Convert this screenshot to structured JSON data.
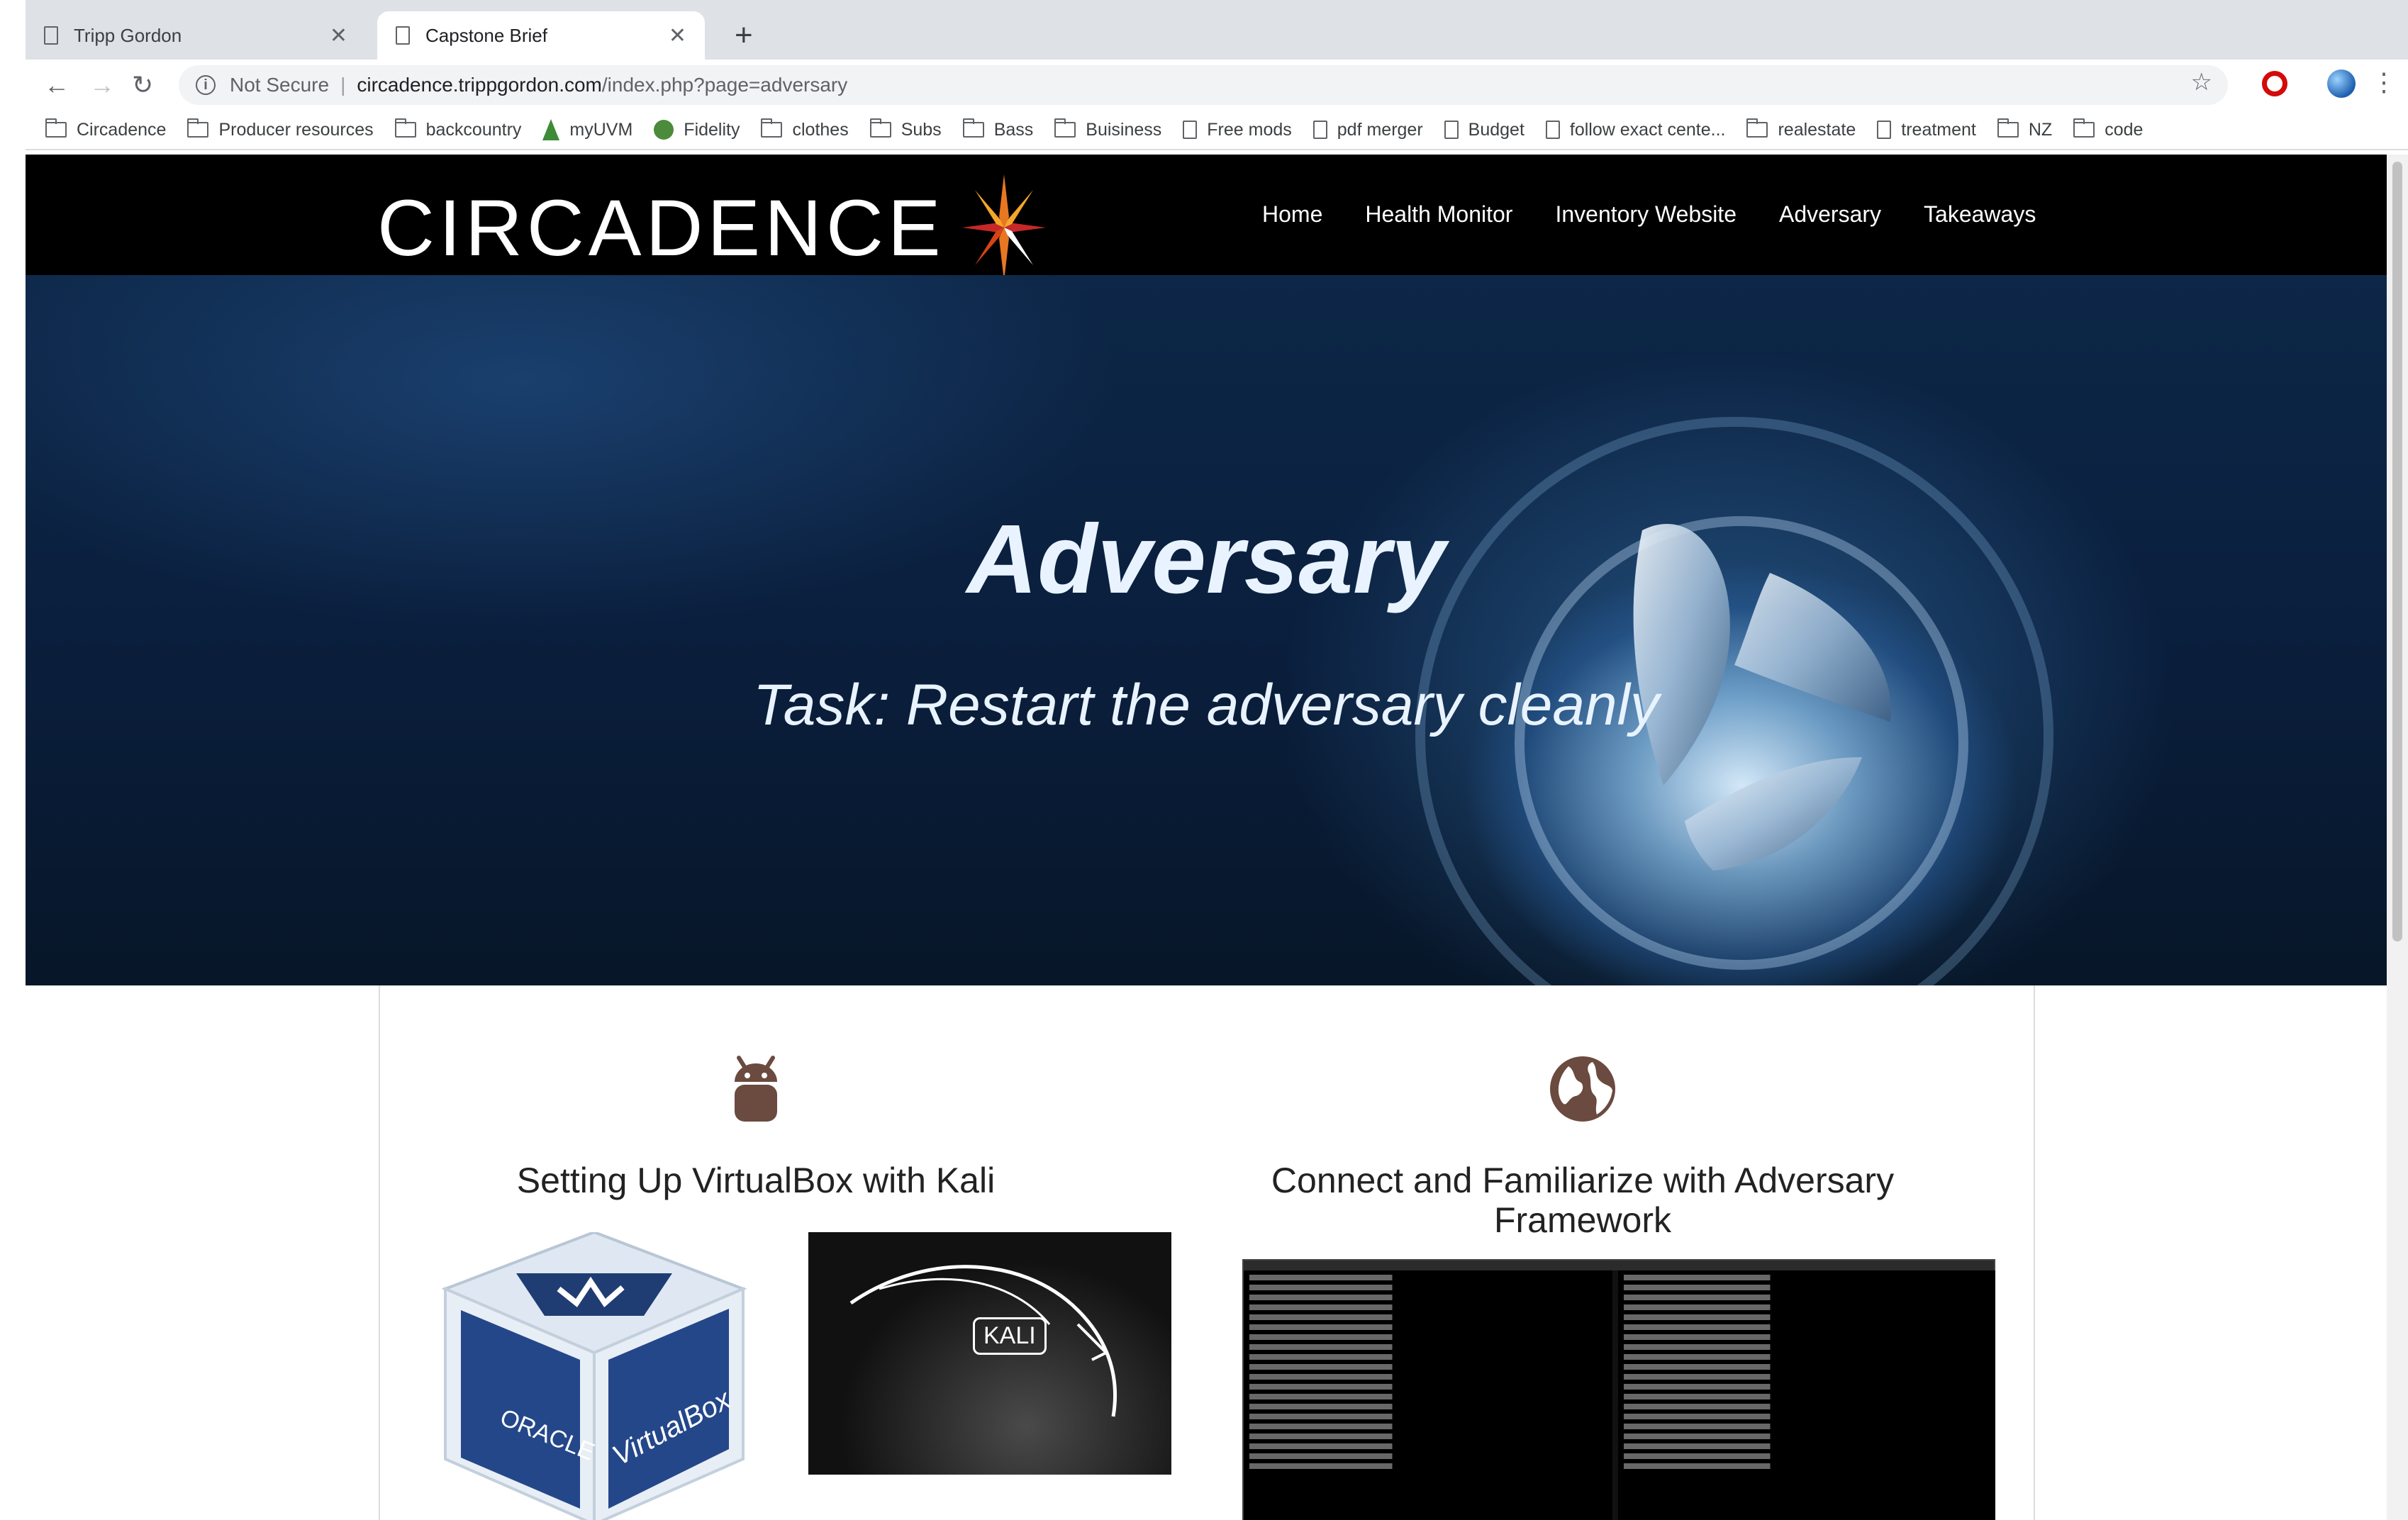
{
  "browser": {
    "tabs": [
      {
        "title": "Tripp Gordon",
        "active": false
      },
      {
        "title": "Capstone Brief",
        "active": true
      }
    ],
    "omnibox": {
      "security": "Not Secure",
      "host": "circadence.trippgordon.com",
      "path": "/index.php?page=adversary"
    },
    "bookmarks": [
      {
        "label": "Circadence",
        "icon": "folder-icon"
      },
      {
        "label": "Producer resources",
        "icon": "folder-icon"
      },
      {
        "label": "backcountry",
        "icon": "folder-icon"
      },
      {
        "label": "myUVM",
        "icon": "tree-icon"
      },
      {
        "label": "Fidelity",
        "icon": "fidelity-icon"
      },
      {
        "label": "clothes",
        "icon": "folder-icon"
      },
      {
        "label": "Subs",
        "icon": "folder-icon"
      },
      {
        "label": "Bass",
        "icon": "folder-icon"
      },
      {
        "label": "Buisiness",
        "icon": "folder-icon"
      },
      {
        "label": "Free mods",
        "icon": "page-icon"
      },
      {
        "label": "pdf merger",
        "icon": "page-icon"
      },
      {
        "label": "Budget",
        "icon": "page-icon"
      },
      {
        "label": "follow exact cente...",
        "icon": "page-icon"
      },
      {
        "label": "realestate",
        "icon": "folder-icon"
      },
      {
        "label": "treatment",
        "icon": "page-icon"
      },
      {
        "label": "NZ",
        "icon": "folder-icon"
      },
      {
        "label": "code",
        "icon": "folder-icon"
      }
    ]
  },
  "site": {
    "logo_text": "CIRCADENCE",
    "nav": [
      "Home",
      "Health Monitor",
      "Inventory Website",
      "Adversary",
      "Takeaways"
    ],
    "hero": {
      "title": "Adversary",
      "subtitle": "Task: Restart the adversary cleanly"
    },
    "cards": [
      {
        "icon": "android-icon",
        "title": "Setting Up VirtualBox with Kali",
        "kali_label": "KALI",
        "vbox_left": "ORACLE",
        "vbox_right": "VirtualBox"
      },
      {
        "icon": "globe-icon",
        "title": "Connect and Familiarize with Adversary Framework"
      }
    ]
  },
  "colors": {
    "nav_bg": "#000000",
    "hero_dark": "#0a1e3c",
    "icon_brown": "#6b4a3f"
  }
}
